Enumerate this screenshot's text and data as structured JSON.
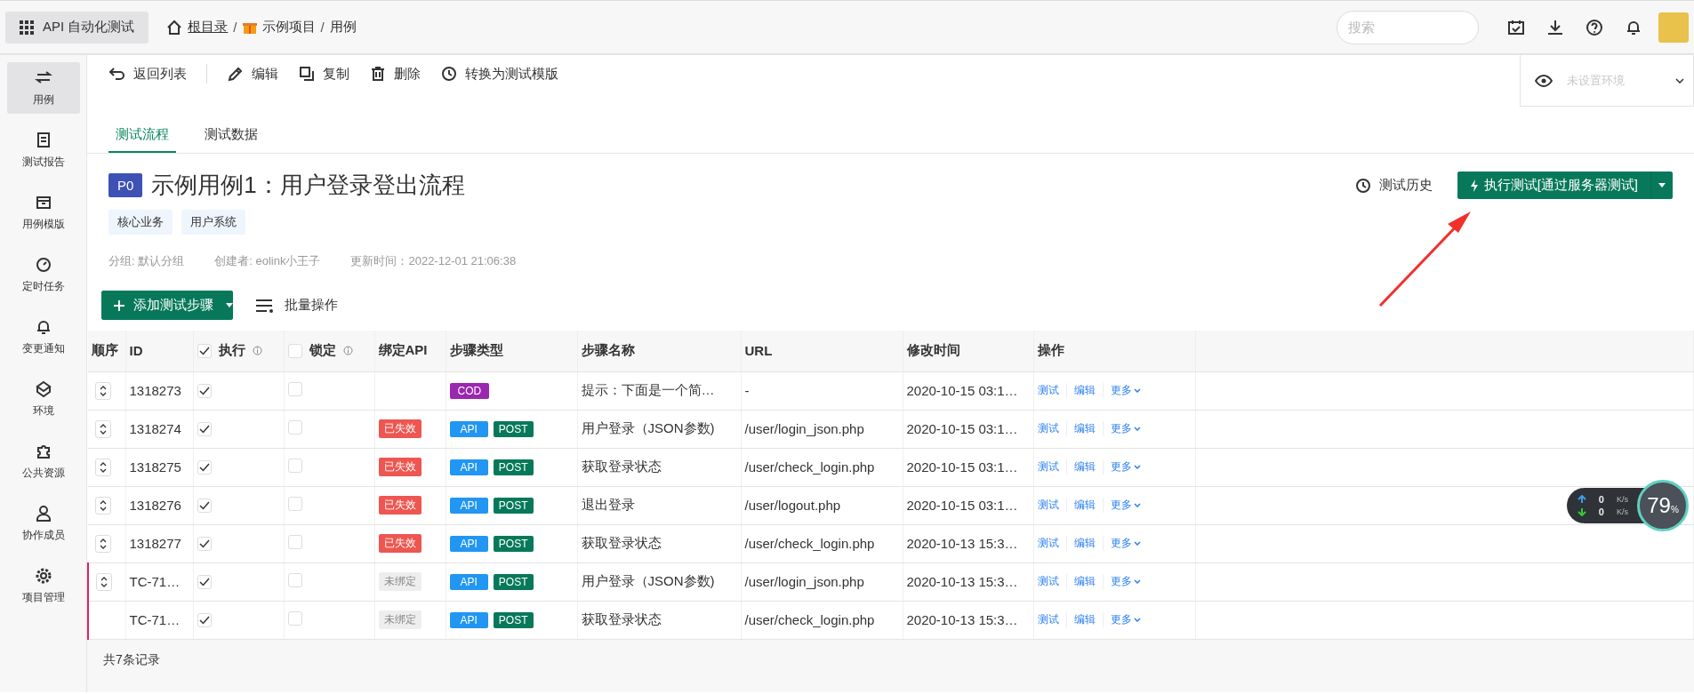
{
  "app_switcher": {
    "label": "API 自动化测试"
  },
  "breadcrumb": [
    {
      "label": "根目录",
      "kind": "home"
    },
    {
      "separator": "/",
      "label": "示例项目",
      "kind": "project"
    },
    {
      "separator": "/",
      "label": "用例",
      "kind": "plain"
    }
  ],
  "search": {
    "placeholder": "搜索"
  },
  "sidebar": {
    "items": [
      {
        "label": "用例",
        "selected": true
      },
      {
        "label": "测试报告",
        "selected": false
      },
      {
        "label": "用例模版",
        "selected": false
      },
      {
        "label": "定时任务",
        "selected": false
      },
      {
        "label": "变更通知",
        "selected": false
      },
      {
        "label": "环境",
        "selected": false
      },
      {
        "label": "公共资源",
        "selected": false
      },
      {
        "label": "协作成员",
        "selected": false
      },
      {
        "label": "项目管理",
        "selected": false
      }
    ]
  },
  "toolbar": [
    {
      "label": "返回列表"
    },
    {
      "label": "编辑"
    },
    {
      "label": "复制"
    },
    {
      "label": "删除"
    },
    {
      "label": "转换为测试模版"
    }
  ],
  "environment": {
    "placeholder": "未设置环境"
  },
  "tabs": [
    {
      "label": "测试流程",
      "selected": true
    },
    {
      "label": "测试数据",
      "selected": false
    }
  ],
  "case": {
    "priority": "P0",
    "title": "示例用例1：用户登录登出流程",
    "tags": [
      "核心业务",
      "用户系统"
    ],
    "meta": [
      "分组: 默认分组",
      "创建者: eolink小王子",
      "更新时间：2022-12-01 21:06:38"
    ]
  },
  "history_link": "测试历史",
  "run_button": "执行测试[通过服务器测试]",
  "add_step_button": "添加测试步骤",
  "batch_button": "批量操作",
  "table": {
    "columns": [
      {
        "label": "顺序"
      },
      {
        "label": "ID"
      },
      {
        "label": "执行",
        "kind": "toggle",
        "checked": true
      },
      {
        "label": "锁定",
        "kind": "toggle",
        "checked": false
      },
      {
        "label": "绑定API"
      },
      {
        "label": "步骤类型"
      },
      {
        "label": "步骤名称"
      },
      {
        "label": "URL"
      },
      {
        "label": "修改时间"
      },
      {
        "label": "操作"
      }
    ],
    "rows": [
      {
        "sortable": true,
        "marked": false,
        "id": "1318273",
        "execute": true,
        "locked": false,
        "binding": null,
        "types": [
          {
            "label": "COD",
            "kind": "cod"
          }
        ],
        "name": "提示：下面是一个简…",
        "url": "-",
        "modified": "2020-10-15 03:1…",
        "actions": [
          "测试",
          "编辑",
          "更多"
        ]
      },
      {
        "sortable": true,
        "marked": false,
        "id": "1318274",
        "execute": true,
        "locked": false,
        "binding": {
          "label": "已失效",
          "kind": "invalid"
        },
        "types": [
          {
            "label": "API",
            "kind": "api"
          },
          {
            "label": "POST",
            "kind": "method"
          }
        ],
        "name": "用户登录（JSON参数)",
        "url": "/user/login_json.php",
        "modified": "2020-10-15 03:1…",
        "actions": [
          "测试",
          "编辑",
          "更多"
        ]
      },
      {
        "sortable": true,
        "marked": false,
        "id": "1318275",
        "execute": true,
        "locked": false,
        "binding": {
          "label": "已失效",
          "kind": "invalid"
        },
        "types": [
          {
            "label": "API",
            "kind": "api"
          },
          {
            "label": "POST",
            "kind": "method"
          }
        ],
        "name": "获取登录状态",
        "url": "/user/check_login.php",
        "modified": "2020-10-15 03:1…",
        "actions": [
          "测试",
          "编辑",
          "更多"
        ]
      },
      {
        "sortable": true,
        "marked": false,
        "id": "1318276",
        "execute": true,
        "locked": false,
        "binding": {
          "label": "已失效",
          "kind": "invalid"
        },
        "types": [
          {
            "label": "API",
            "kind": "api"
          },
          {
            "label": "POST",
            "kind": "method"
          }
        ],
        "name": "退出登录",
        "url": "/user/logout.php",
        "modified": "2020-10-15 03:1…",
        "actions": [
          "测试",
          "编辑",
          "更多"
        ]
      },
      {
        "sortable": true,
        "marked": false,
        "id": "1318277",
        "execute": true,
        "locked": false,
        "binding": {
          "label": "已失效",
          "kind": "invalid"
        },
        "types": [
          {
            "label": "API",
            "kind": "api"
          },
          {
            "label": "POST",
            "kind": "method"
          }
        ],
        "name": "获取登录状态",
        "url": "/user/check_login.php",
        "modified": "2020-10-13 15:3…",
        "actions": [
          "测试",
          "编辑",
          "更多"
        ]
      },
      {
        "sortable": true,
        "marked": true,
        "id": "TC-71…",
        "execute": true,
        "locked": false,
        "binding": {
          "label": "未绑定",
          "kind": "unbound"
        },
        "types": [
          {
            "label": "API",
            "kind": "api"
          },
          {
            "label": "POST",
            "kind": "method"
          }
        ],
        "name": "用户登录（JSON参数)",
        "url": "/user/login_json.php",
        "modified": "2020-10-13 15:3…",
        "actions": [
          "测试",
          "编辑",
          "更多"
        ]
      },
      {
        "sortable": false,
        "marked": true,
        "id": "TC-71…",
        "execute": true,
        "locked": false,
        "binding": {
          "label": "未绑定",
          "kind": "unbound"
        },
        "types": [
          {
            "label": "API",
            "kind": "api"
          },
          {
            "label": "POST",
            "kind": "method"
          }
        ],
        "name": "获取登录状态",
        "url": "/user/check_login.php",
        "modified": "2020-10-13 15:3…",
        "actions": [
          "测试",
          "编辑",
          "更多"
        ]
      }
    ]
  },
  "footer": "共7条记录",
  "speed_widget": {
    "up": "0",
    "up_unit": "K/s",
    "down": "0",
    "down_unit": "K/s",
    "percent": "79",
    "percent_sign": "%"
  }
}
